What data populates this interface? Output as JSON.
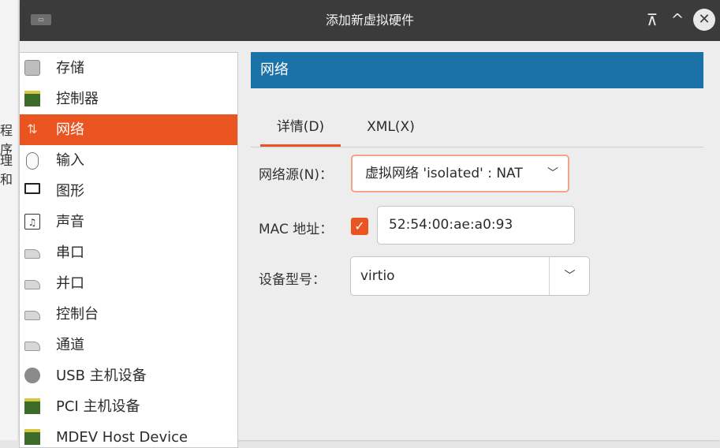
{
  "background_window": {
    "fragments": [
      "程序",
      "理和"
    ]
  },
  "titlebar": {
    "app_icon": "window-icon",
    "title": "添加新虚拟硬件",
    "buttons": {
      "minimize_icon": "minimize-icon",
      "maximize_icon": "maximize-icon",
      "close_icon": "close-icon"
    }
  },
  "hardware_list": {
    "selected": "网络",
    "items": [
      {
        "label": "存储",
        "icon": "storage-icon"
      },
      {
        "label": "控制器",
        "icon": "controller-card-icon"
      },
      {
        "label": "网络",
        "icon": "network-icon"
      },
      {
        "label": "输入",
        "icon": "mouse-icon"
      },
      {
        "label": "图形",
        "icon": "monitor-icon"
      },
      {
        "label": "声音",
        "icon": "sound-icon"
      },
      {
        "label": "串口",
        "icon": "serial-port-icon"
      },
      {
        "label": "并口",
        "icon": "parallel-port-icon"
      },
      {
        "label": "控制台",
        "icon": "console-icon"
      },
      {
        "label": "通道",
        "icon": "channel-icon"
      },
      {
        "label": "USB 主机设备",
        "icon": "usb-icon"
      },
      {
        "label": "PCI 主机设备",
        "icon": "pci-card-icon"
      },
      {
        "label": "MDEV Host Device",
        "icon": "mdev-card-icon"
      }
    ]
  },
  "main": {
    "section_title": "网络",
    "tabs": [
      {
        "label": "详情(D)",
        "active": true
      },
      {
        "label": "XML(X)",
        "active": false
      }
    ],
    "form": {
      "network_source": {
        "label": "网络源(N)：",
        "value": "虚拟网络 'isolated' : NAT"
      },
      "mac": {
        "label": "MAC 地址：",
        "checked": true,
        "value": "52:54:00:ae:a0:93"
      },
      "device_model": {
        "label": "设备型号：",
        "value": "virtio"
      }
    }
  },
  "colors": {
    "accent": "#e95420",
    "header": "#1b72a8",
    "titlebar": "#3b3b3b"
  }
}
